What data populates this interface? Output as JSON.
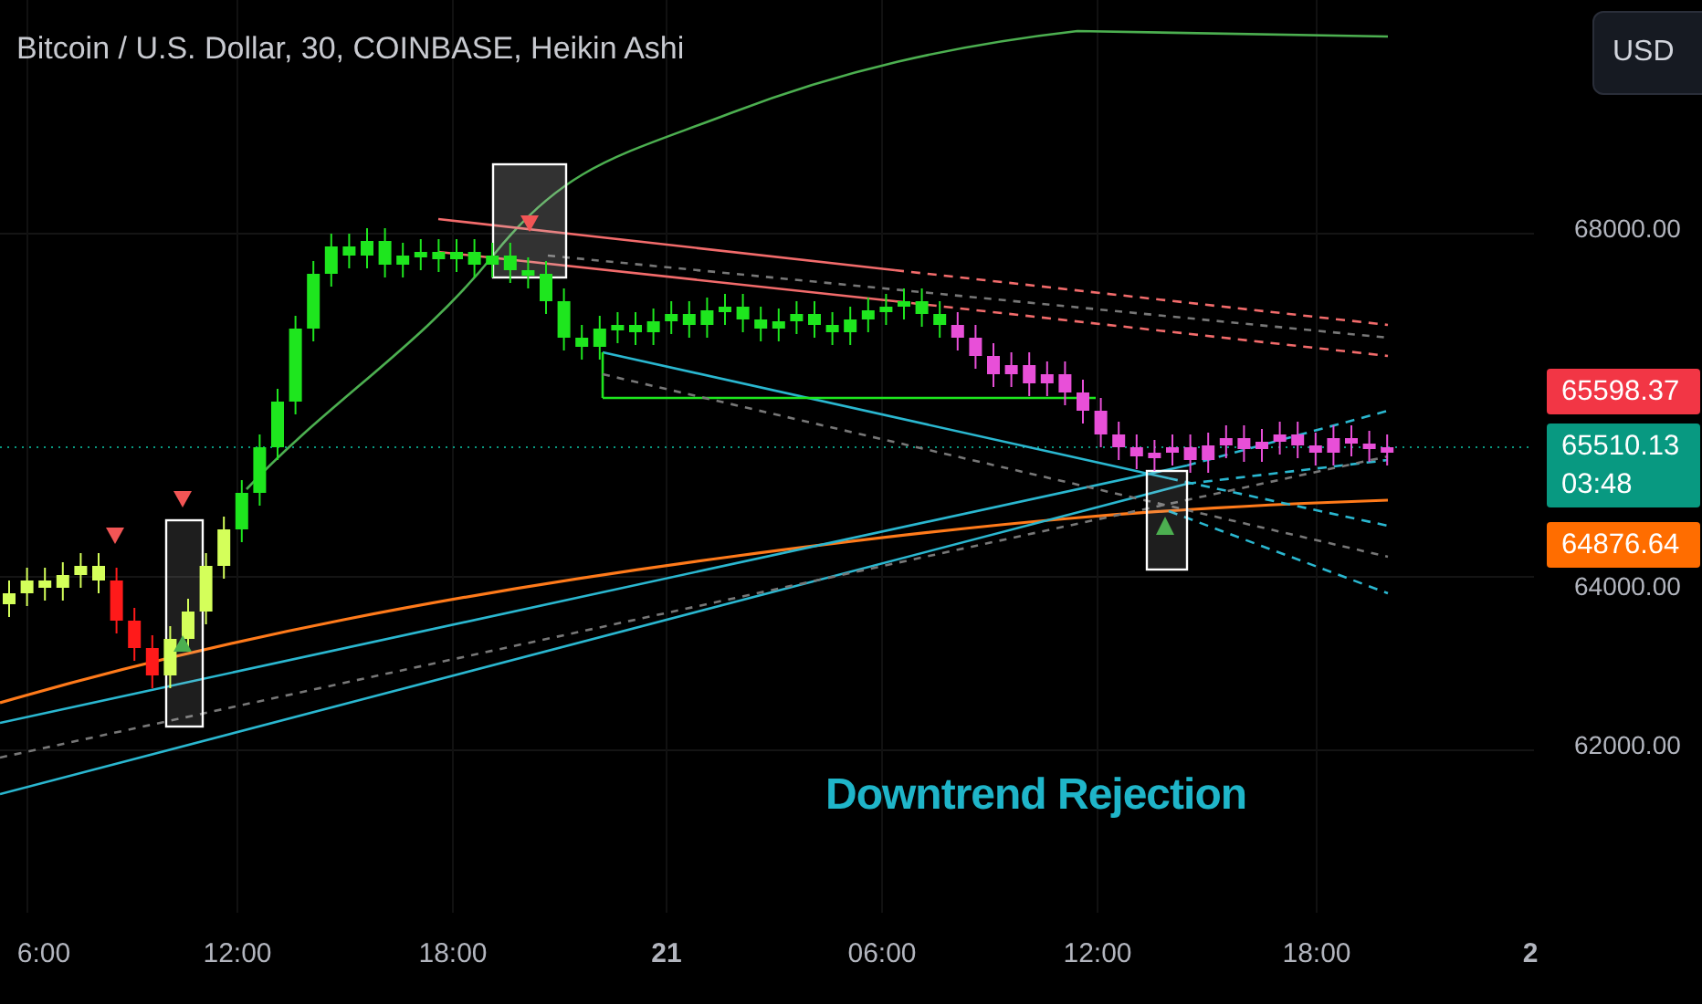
{
  "chart": {
    "title": "Bitcoin / U.S. Dollar, 30, COINBASE, Heikin Ashi",
    "annotation": "Downtrend Rejection"
  },
  "currency_button": "USD",
  "price_ticks": [
    "68000.00",
    "64000.00",
    "62000.00"
  ],
  "price_labels": [
    {
      "kind": "high",
      "value": "65598.37",
      "color": "#f23645"
    },
    {
      "kind": "last",
      "value": "65510.13",
      "countdown": "03:48",
      "color": "#089981"
    },
    {
      "kind": "ma",
      "value": "64876.64",
      "color": "#ff6d00"
    }
  ],
  "time_axis": [
    {
      "label": "6:00",
      "bold": false
    },
    {
      "label": "12:00",
      "bold": false
    },
    {
      "label": "18:00",
      "bold": false
    },
    {
      "label": "21",
      "bold": true
    },
    {
      "label": "06:00",
      "bold": false
    },
    {
      "label": "12:00",
      "bold": false
    },
    {
      "label": "18:00",
      "bold": false
    },
    {
      "label": "2",
      "bold": true
    }
  ]
}
